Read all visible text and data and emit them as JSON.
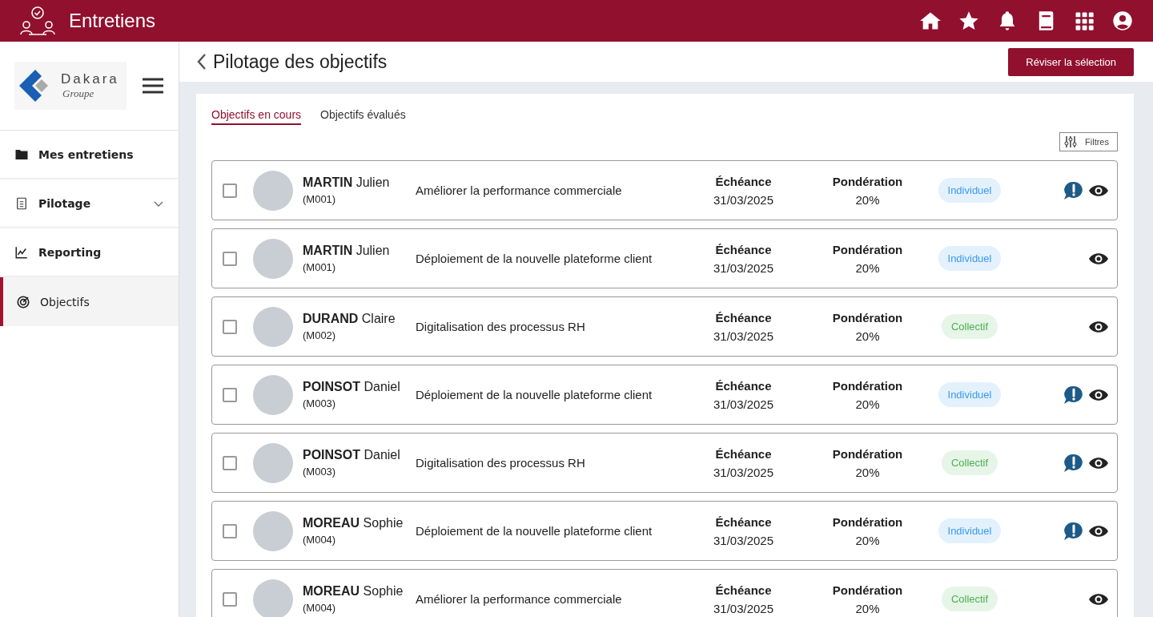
{
  "app_bar": {
    "title": "Entretiens"
  },
  "sidebar": {
    "logo": {
      "name": "Dakara",
      "subtitle": "Groupe"
    },
    "items": [
      {
        "label": "Mes entretiens",
        "kind": "link",
        "selected": false
      },
      {
        "label": "Pilotage",
        "kind": "group",
        "selected": false
      },
      {
        "label": "Reporting",
        "kind": "link",
        "selected": false
      },
      {
        "label": "Objectifs",
        "kind": "link",
        "selected": true
      }
    ]
  },
  "page": {
    "title": "Pilotage des objectifs",
    "action": "Réviser la sélection"
  },
  "tabs": [
    {
      "label": "Objectifs en cours",
      "selected": true
    },
    {
      "label": "Objectifs évalués",
      "selected": false
    }
  ],
  "filter_button": "Filtres",
  "rows": [
    {
      "checked": false,
      "name": "**MARTIN** Julien",
      "code": "(M001)",
      "objective": "Améliorer la performance commerciale",
      "due_label": "Échéance",
      "due": "31/03/2025",
      "weight_label": "Pondération",
      "weight": "20%",
      "tag": {
        "label": "Individuel",
        "kind": "individuel"
      },
      "alert": true
    },
    {
      "checked": false,
      "name": "**MARTIN** Julien",
      "code": "(M001)",
      "objective": "Déploiement de la nouvelle plateforme client",
      "due_label": "Échéance",
      "due": "31/03/2025",
      "weight_label": "Pondération",
      "weight": "20%",
      "tag": {
        "label": "Individuel",
        "kind": "individuel"
      },
      "alert": false
    },
    {
      "checked": false,
      "name": "**DURAND** Claire",
      "code": "(M002)",
      "objective": "Digitalisation des processus RH",
      "due_label": "Échéance",
      "due": "31/03/2025",
      "weight_label": "Pondération",
      "weight": "20%",
      "tag": {
        "label": "Collectif",
        "kind": "collectif"
      },
      "alert": false
    },
    {
      "checked": false,
      "name": "**POINSOT** Daniel",
      "code": "(M003)",
      "objective": "Déploiement de la nouvelle plateforme client",
      "due_label": "Échéance",
      "due": "31/03/2025",
      "weight_label": "Pondération",
      "weight": "20%",
      "tag": {
        "label": "Individuel",
        "kind": "individuel"
      },
      "alert": true
    },
    {
      "checked": false,
      "name": "**POINSOT** Daniel",
      "code": "(M003)",
      "objective": "Digitalisation des processus RH",
      "due_label": "Échéance",
      "due": "31/03/2025",
      "weight_label": "Pondération",
      "weight": "20%",
      "tag": {
        "label": "Collectif",
        "kind": "collectif"
      },
      "alert": true
    },
    {
      "checked": false,
      "name": "**MOREAU** Sophie",
      "code": "(M004)",
      "objective": "Déploiement de la nouvelle plateforme client",
      "due_label": "Échéance",
      "due": "31/03/2025",
      "weight_label": "Pondération",
      "weight": "20%",
      "tag": {
        "label": "Individuel",
        "kind": "individuel"
      },
      "alert": true
    },
    {
      "checked": false,
      "name": "**MOREAU** Sophie",
      "code": "(M004)",
      "objective": "Améliorer la performance commerciale",
      "due_label": "Échéance",
      "due": "31/03/2025",
      "weight_label": "Pondération",
      "weight": "20%",
      "tag": {
        "label": "Collectif",
        "kind": "collectif"
      },
      "alert": false
    }
  ]
}
